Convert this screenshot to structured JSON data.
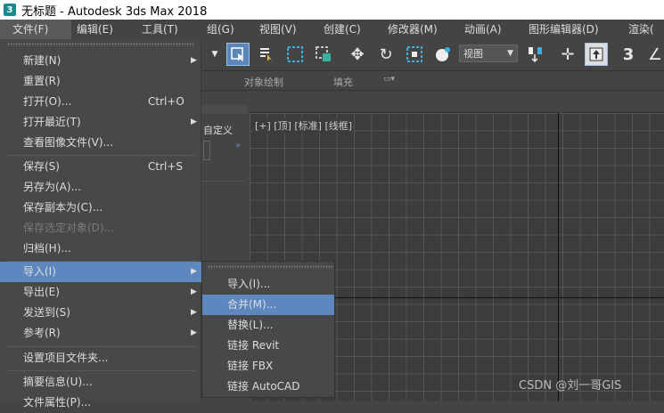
{
  "window": {
    "title": "无标题 - Autodesk 3ds Max 2018",
    "icon": "3"
  },
  "menubar": [
    "文件(F)",
    "编辑(E)",
    "工具(T)",
    "组(G)",
    "视图(V)",
    "创建(C)",
    "修改器(M)",
    "动画(A)",
    "图形编辑器(D)",
    "渲染("
  ],
  "toolbar": {
    "view_dropdown": "视图"
  },
  "ribbon": {
    "object_paint": "对象绘制",
    "fill": "填充"
  },
  "left_panel": {
    "label": "自定义",
    "arrow": "»"
  },
  "viewport": {
    "label": "[+] [顶] [标准] [线框]"
  },
  "file_menu": {
    "items": [
      {
        "label": "新建(N)",
        "shortcut": "",
        "arrow": "▶"
      },
      {
        "label": "重置(R)",
        "shortcut": "",
        "arrow": ""
      },
      {
        "label": "打开(O)...",
        "shortcut": "Ctrl+O",
        "arrow": ""
      },
      {
        "label": "打开最近(T)",
        "shortcut": "",
        "arrow": "▶"
      },
      {
        "label": "查看图像文件(V)...",
        "shortcut": "",
        "arrow": ""
      },
      {
        "label": "保存(S)",
        "shortcut": "Ctrl+S",
        "arrow": ""
      },
      {
        "label": "另存为(A)...",
        "shortcut": "",
        "arrow": ""
      },
      {
        "label": "保存副本为(C)...",
        "shortcut": "",
        "arrow": ""
      },
      {
        "label": "保存选定对象(D)...",
        "shortcut": "",
        "arrow": ""
      },
      {
        "label": "归档(H)...",
        "shortcut": "",
        "arrow": ""
      },
      {
        "label": "导入(I)",
        "shortcut": "",
        "arrow": "▶"
      },
      {
        "label": "导出(E)",
        "shortcut": "",
        "arrow": "▶"
      },
      {
        "label": "发送到(S)",
        "shortcut": "",
        "arrow": "▶"
      },
      {
        "label": "参考(R)",
        "shortcut": "",
        "arrow": "▶"
      },
      {
        "label": "设置项目文件夹...",
        "shortcut": "",
        "arrow": ""
      },
      {
        "label": "摘要信息(U)...",
        "shortcut": "",
        "arrow": ""
      },
      {
        "label": "文件属性(P)...",
        "shortcut": "",
        "arrow": ""
      }
    ]
  },
  "import_submenu": {
    "items": [
      "导入(I)...",
      "合并(M)...",
      "替换(L)...",
      "链接 Revit",
      "链接 FBX",
      "链接 AutoCAD"
    ]
  },
  "watermark": "CSDN @刘一哥GIS"
}
